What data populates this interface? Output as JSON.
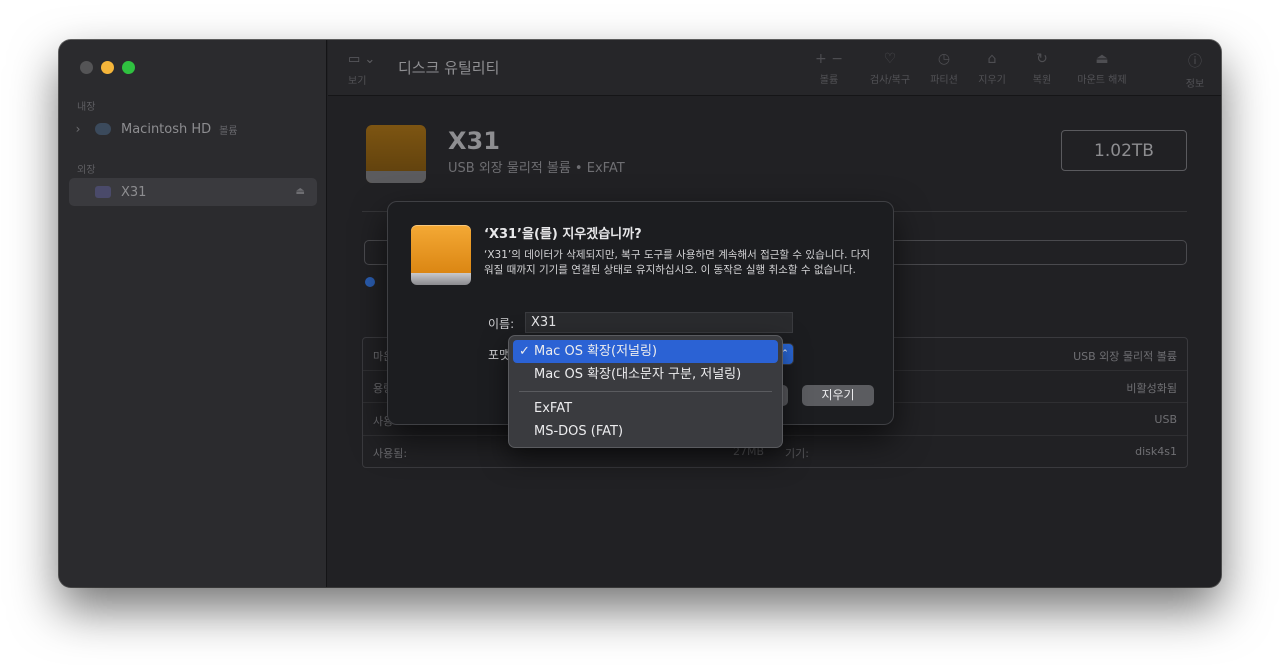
{
  "sidebar": {
    "section_internal": "내장",
    "section_external": "외장",
    "items": [
      {
        "label": "Macintosh HD",
        "sub": "볼륨"
      },
      {
        "label": "X31"
      }
    ]
  },
  "toolbar": {
    "view_label": "보기",
    "title": "디스크 유틸리티",
    "buttons": [
      {
        "label": "볼륨",
        "icon": "+  −"
      },
      {
        "label": "검사/복구",
        "icon": "♡"
      },
      {
        "label": "파티션",
        "icon": "◷"
      },
      {
        "label": "지우기",
        "icon": "⌂"
      },
      {
        "label": "복원",
        "icon": "↻"
      },
      {
        "label": "마운트 해제",
        "icon": "⏏"
      },
      {
        "label": "정보",
        "icon": "ⓘ"
      }
    ]
  },
  "volume": {
    "name": "X31",
    "subtitle": "USB 외장 물리적 볼륨 • ExFAT",
    "size": "1.02TB"
  },
  "info": {
    "rows": [
      {
        "left": "마운",
        "right": "USB 외장 물리적 볼륨"
      },
      {
        "left": "용량",
        "right": "비활성화됨"
      },
      {
        "left": "사용",
        "right": "USB"
      },
      {
        "left": "사용됨:",
        "mid": "27MB",
        "midlabel": "기기:",
        "right": "disk4s1"
      }
    ]
  },
  "dialog": {
    "title": "‘X31’을(를) 지우겠습니까?",
    "message": "‘X31’의 데이터가 삭제되지만, 복구 도구를 사용하면 계속해서 접근할 수 있습니다. 다지워질 때까지 기기를 연결된 상태로 유지하십시오. 이 동작은 실행 취소할 수 없습니다.",
    "name_label": "이름:",
    "name_value": "X31",
    "format_label": "포맷",
    "erase_button": "지우기"
  },
  "format_menu": {
    "selected_check": "✓",
    "options": [
      "Mac OS 확장(저널링)",
      "Mac OS 확장(대소문자 구분, 저널링)",
      "ExFAT",
      "MS-DOS (FAT)"
    ]
  },
  "colors": {
    "accent": "#2b62d4",
    "disk_orange": "#f4a935",
    "close_button": "#545456",
    "minimize_button": "#f5b53a",
    "zoom_button": "#2fc140"
  }
}
